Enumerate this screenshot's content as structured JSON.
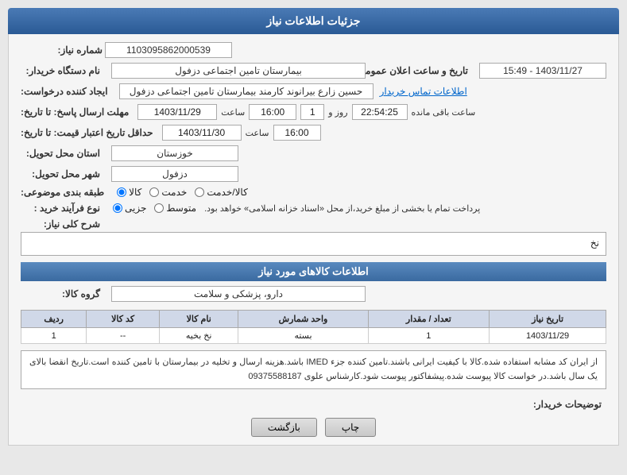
{
  "header": {
    "title": "جزئیات اطلاعات نیاز"
  },
  "fields": {
    "shomara_niaz_label": "شماره نیاز:",
    "shomara_niaz_value": "1103095862000539",
    "nam_dastgah_label": "نام دستگاه خریدار:",
    "nam_dastgah_value": "بیمارستان تامین اجتماعی دزفول",
    "ijad_label": "ایجاد کننده درخواست:",
    "ijad_value": "حسین زارع بیرانوند کارمند بیمارستان تامین اجتماعی دزفول",
    "ijad_link": "اطلاعات تماس خریدار",
    "tarikh_ersal_label": "مهلت ارسال پاسخ: تا تاریخ:",
    "tarikh_ersal_date": "1403/11/29",
    "tarikh_ersal_saat_label": "ساعت",
    "tarikh_ersal_saat": "16:00",
    "tarikh_ersal_rooz_label": "روز و",
    "tarikh_ersal_rooz": "1",
    "tarikh_ersal_remaining_label": "ساعت باقی مانده",
    "tarikh_ersal_remaining": "22:54:25",
    "hadaghall_label": "حداقل تاریخ اعتبار قیمت: تا تاریخ:",
    "hadaghall_date": "1403/11/30",
    "hadaghall_saat_label": "ساعت",
    "hadaghall_saat": "16:00",
    "ostan_label": "استان محل تحویل:",
    "ostan_value": "خوزستان",
    "shahr_label": "شهر محل تحویل:",
    "shahr_value": "دزفول",
    "tabaghe_label": "طبقه بندی موضوعی:",
    "tabaghe_kala": "کالا",
    "tabaghe_khadamat": "خدمت",
    "tabaghe_kala_khadamat": "کالا/خدمت",
    "now_farayand_label": "نوع فرآیند خرید :",
    "now_farayand_jozyi": "جزیی",
    "now_farayand_motevaset": "متوسط",
    "now_farayand_desc": "پرداخت تمام یا بخشی از مبلغ خرید،از محل «اسناد خزانه اسلامی» خواهد بود.",
    "tarikh_elan_label": "تاریخ و ساعت اعلان عمومی:",
    "tarikh_elan_value": "1403/11/27 - 15:49",
    "sharh_label": "شرح کلی نیاز:",
    "sharh_value": "نخ",
    "section_kalahai": "اطلاعات کالاهای مورد نیاز",
    "group_kala_label": "گروه کالا:",
    "group_kala_value": "دارو، پزشکی و سلامت",
    "table_headers": {
      "radif": "ردیف",
      "kod_kala": "کد کالا",
      "nam_kala": "نام کالا",
      "vahed_shomares": "واحد شمارش",
      "tedad_meghdaar": "تعداد / مقدار",
      "tarikh_niaz": "تاریخ نیاز"
    },
    "table_rows": [
      {
        "radif": "1",
        "kod_kala": "--",
        "nam_kala": "نخ بخیه",
        "vahed_shomares": "بسته",
        "tedad_meghdaar": "1",
        "tarikh_niaz": "1403/11/29"
      }
    ],
    "notice_text": "از ایران کد مشابه استفاده شده.کالا با کیفیت ایرانی باشند.تامین کننده جزء IMED باشد.هزینه ارسال و تخلیه در بیمارستان با تامین کننده است.تاریخ انقضا بالای یک سال باشد.در خواست کالا پیوست شده.پیشفاکتور پیوست شود.کارشناس علوی 09375588187",
    "tazvihat_label": "توضیحات خریدار:",
    "btn_chap": "چاپ",
    "btn_bazgasht": "بازگشت"
  }
}
